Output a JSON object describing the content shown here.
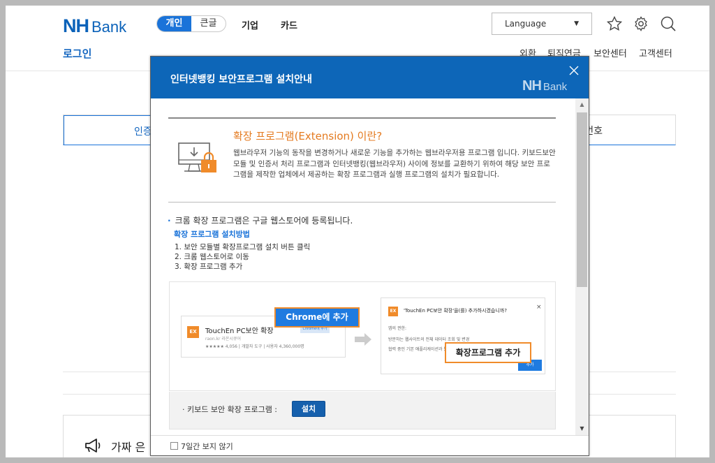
{
  "header": {
    "logo_main": "NH",
    "logo_sub": "Bank",
    "segment": [
      "개인",
      "큰글"
    ],
    "nav": [
      "기업",
      "카드"
    ],
    "login": "로그인",
    "language": "Language",
    "subnav": [
      "외환",
      "퇴직연금",
      "보안센터",
      "고객센터"
    ]
  },
  "page": {
    "tab_left_partial": "인증",
    "tab_right_partial": "번호",
    "notice_partial": "가짜 은"
  },
  "modal": {
    "title": "인터넷뱅킹 보안프로그램 설치안내",
    "logo_main": "NH",
    "logo_sub": "Bank",
    "ext_title": "확장 프로그램(Extension) 이란?",
    "ext_desc": "웹브라우저 기능의 동작을 변경하거나 새로운 기능을 추가하는 웹브라우저용 프로그램 입니다. 키보드보안 모듈 및 인증서 처리 프로그램과 인터넷뱅킹(웹브라우저) 사이에 정보를 교환하기 위하여 해당 보안 프로그램을 제작한 업체에서 제공하는 확장 프로그램과 실행 프로그램의 설치가 필요합니다.",
    "bullet": "크롬 확장 프로그램은 구글 웹스토어에 등록됩니다.",
    "howto_title": "확장 프로그램 설치방법",
    "steps": [
      "1. 보안 모듈별 확장프로그램 설치 버튼 클릭",
      "2. 크롬 웹스토어로 이동",
      "3. 확장 프로그램 추가"
    ],
    "guide": {
      "ext_badge": "EX",
      "card1_title": "TouchEn PC보안 확장",
      "card1_sub1": "raon.kr 라온시큐어",
      "card1_sub2": "★★★★★ 4,056 | 개발자 도구 | 사용자 4,360,000명",
      "card1_mini": "Chrome에 추가",
      "callout1": "Chrome에 추가",
      "card2_title": "'TouchEn PC보안 확장'을(를) 추가하시겠습니까?",
      "card2_close": "×",
      "card2_perm": "앱의 권한:",
      "card2_line1": "방문하는 웹사이트의 전체 데이터 조회 및 변경",
      "card2_line2": "협력 중인 기본 애플리케이션과 통신",
      "card2_btn": "추가",
      "callout2": "확장프로그램 추가"
    },
    "install_label": "키보드 보안 확장 프로그램 :",
    "install_button": "설치",
    "footer_checkbox": "7일간 보지 않기"
  }
}
